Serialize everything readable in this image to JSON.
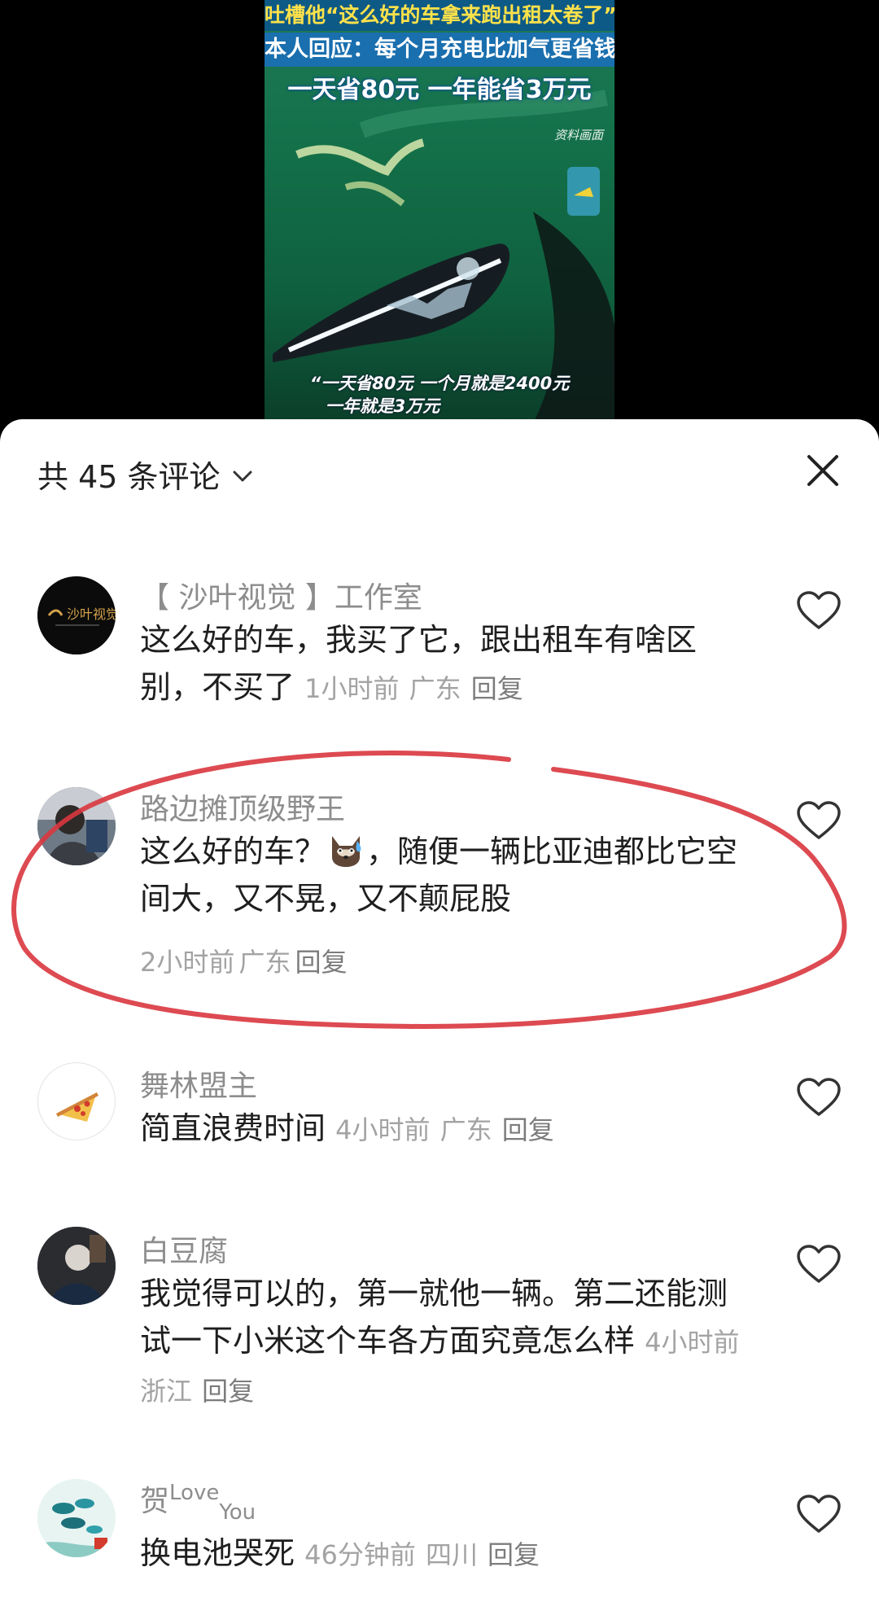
{
  "video": {
    "headline_1": "吐槽他“这么好的车拿来跑出租太卷了”",
    "headline_2": "本人回应：每个月充电比加气更省钱",
    "headline_3": "一天省80元 一年能省3万元",
    "source_tag": "资料画面",
    "caption_1": "“一天省80元 一个月就是2400元",
    "caption_2": "一年就是3万元",
    "colors": {
      "body": "#137049",
      "banner": "#1a6fae",
      "headline_yellow": "#ffe24a"
    }
  },
  "sheet": {
    "title": "共 45 条评论",
    "chevron_icon": "chevron-down-icon",
    "close_icon": "close-icon"
  },
  "comments": [
    {
      "username": "【 沙叶视觉 】工作室",
      "text": "这么好的车，我买了它，跟出租车有啥区别，不买了",
      "time": "1小时前",
      "location": "广东",
      "reply": "回复",
      "avatar": "logo-avatar"
    },
    {
      "username": "路边摊顶级野王",
      "text": "这么好的车？",
      "text_emoji": "dog-sweat-emoji",
      "text_tail": "，随便一辆比亚迪都比它空间大，又不晃，又不颠屁股",
      "time": "2小时前",
      "location": "广东",
      "reply": "回复",
      "avatar": "photo-avatar",
      "highlighted": true
    },
    {
      "username": "舞林盟主",
      "text": "简直浪费时间",
      "time": "4小时前",
      "location": "广东",
      "reply": "回复",
      "avatar": "pizza-avatar"
    },
    {
      "username": "白豆腐",
      "text": "我觉得可以的，第一就他一辆。第二还能测试一下小米这个车各方面究竟怎么样",
      "time": "4小时前",
      "location": "浙江",
      "reply": "回复",
      "avatar": "photo-avatar"
    },
    {
      "username_main": "贺",
      "username_sup": "Love",
      "username_sub": "You",
      "text": "换电池哭死",
      "time": "46分钟前",
      "location": "四川",
      "reply": "回复",
      "avatar": "fish-avatar"
    }
  ],
  "accent": {
    "annotation_red": "#d9363e",
    "muted_text": "#8d8d8d"
  }
}
